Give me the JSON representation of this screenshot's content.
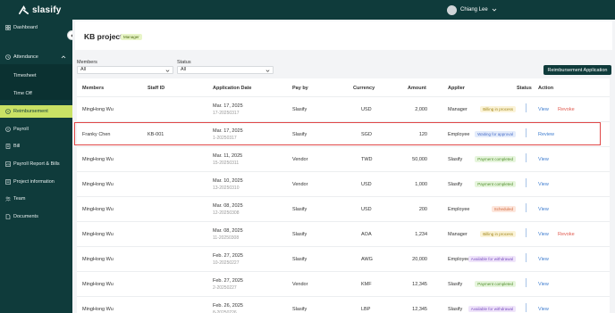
{
  "app": {
    "name": "slasify"
  },
  "user": {
    "name": "Chiang Lee"
  },
  "sidebar": {
    "items": [
      {
        "label": "Dashboard",
        "icon": "grid-icon"
      },
      {
        "label": "Attendance",
        "icon": "clock-icon"
      },
      {
        "label": "Timesheet"
      },
      {
        "label": "Time Off"
      },
      {
        "label": "Reimbursement",
        "icon": "receipt-icon"
      },
      {
        "label": "Payroll",
        "icon": "coin-icon"
      },
      {
        "label": "Bill",
        "icon": "bill-icon"
      },
      {
        "label": "Payroll Report & Bills",
        "icon": "report-icon"
      },
      {
        "label": "Project information",
        "icon": "folder-icon"
      },
      {
        "label": "Team",
        "icon": "team-icon"
      },
      {
        "label": "Documents",
        "icon": "document-icon"
      }
    ]
  },
  "page": {
    "title": "KB project",
    "role_badge": "Manager"
  },
  "filters": {
    "members_label": "Members",
    "members_value": "All",
    "status_label": "Status",
    "status_value": "All"
  },
  "actions": {
    "primary": "Reimbursement Application"
  },
  "table": {
    "headers": [
      "Members",
      "Staff ID",
      "Application Date",
      "Pay by",
      "Currency",
      "Amount",
      "Applier",
      "Status",
      "Action"
    ],
    "rows": [
      {
        "member": "MingHong Wu",
        "staff_id": "",
        "date": "Mar. 17, 2025",
        "app_no": "17-20250317",
        "pay_by": "Slasify",
        "currency": "USD",
        "amount": "2,000",
        "applier": "Manager",
        "status": "Billing in process",
        "status_kind": "billing",
        "action1": "View",
        "action2": "Revoke"
      },
      {
        "member": "Franky Chen",
        "staff_id": "KB-001",
        "date": "Mar. 17, 2025",
        "app_no": "1-20250317",
        "pay_by": "Slasify",
        "currency": "SGD",
        "amount": "120",
        "applier": "Employee",
        "status": "Waiting for approval",
        "status_kind": "waiting",
        "action1": "Review",
        "action2": ""
      },
      {
        "member": "MingHong Wu",
        "staff_id": "",
        "date": "Mar. 11, 2025",
        "app_no": "15-20250311",
        "pay_by": "Vendor",
        "currency": "TWD",
        "amount": "50,000",
        "applier": "Slasify",
        "status": "Payment completed",
        "status_kind": "completed",
        "action1": "View",
        "action2": ""
      },
      {
        "member": "MingHong Wu",
        "staff_id": "",
        "date": "Mar. 10, 2025",
        "app_no": "13-20250310",
        "pay_by": "Vendor",
        "currency": "USD",
        "amount": "1,000",
        "applier": "Slasify",
        "status": "Payment completed",
        "status_kind": "completed",
        "action1": "View",
        "action2": ""
      },
      {
        "member": "MingHong Wu",
        "staff_id": "",
        "date": "Mar. 08, 2025",
        "app_no": "12-20250308",
        "pay_by": "Slasify",
        "currency": "USD",
        "amount": "200",
        "applier": "Employee",
        "status": "Scheduled",
        "status_kind": "scheduled",
        "action1": "View",
        "action2": ""
      },
      {
        "member": "MingHong Wu",
        "staff_id": "",
        "date": "Mar. 08, 2025",
        "app_no": "11-20250308",
        "pay_by": "Slasify",
        "currency": "AOA",
        "amount": "1,234",
        "applier": "Manager",
        "status": "Billing in process",
        "status_kind": "billing",
        "action1": "View",
        "action2": "Revoke"
      },
      {
        "member": "MingHong Wu",
        "staff_id": "",
        "date": "Feb. 27, 2025",
        "app_no": "10-20250227",
        "pay_by": "Slasify",
        "currency": "AWG",
        "amount": "20,000",
        "applier": "Employee",
        "status": "Available for withdrawal",
        "status_kind": "available",
        "action1": "View",
        "action2": ""
      },
      {
        "member": "MingHong Wu",
        "staff_id": "",
        "date": "Feb. 27, 2025",
        "app_no": "2-20250227",
        "pay_by": "Vendor",
        "currency": "KMF",
        "amount": "12,345",
        "applier": "Slasify",
        "status": "Payment completed",
        "status_kind": "completed",
        "action1": "View",
        "action2": ""
      },
      {
        "member": "MingHong Wu",
        "staff_id": "",
        "date": "Feb. 26, 2025",
        "app_no": "8-20250226",
        "pay_by": "Slasify",
        "currency": "LBP",
        "amount": "12,345",
        "applier": "Slasify",
        "status": "Available for withdrawal",
        "status_kind": "available",
        "action1": "View",
        "action2": ""
      }
    ]
  }
}
